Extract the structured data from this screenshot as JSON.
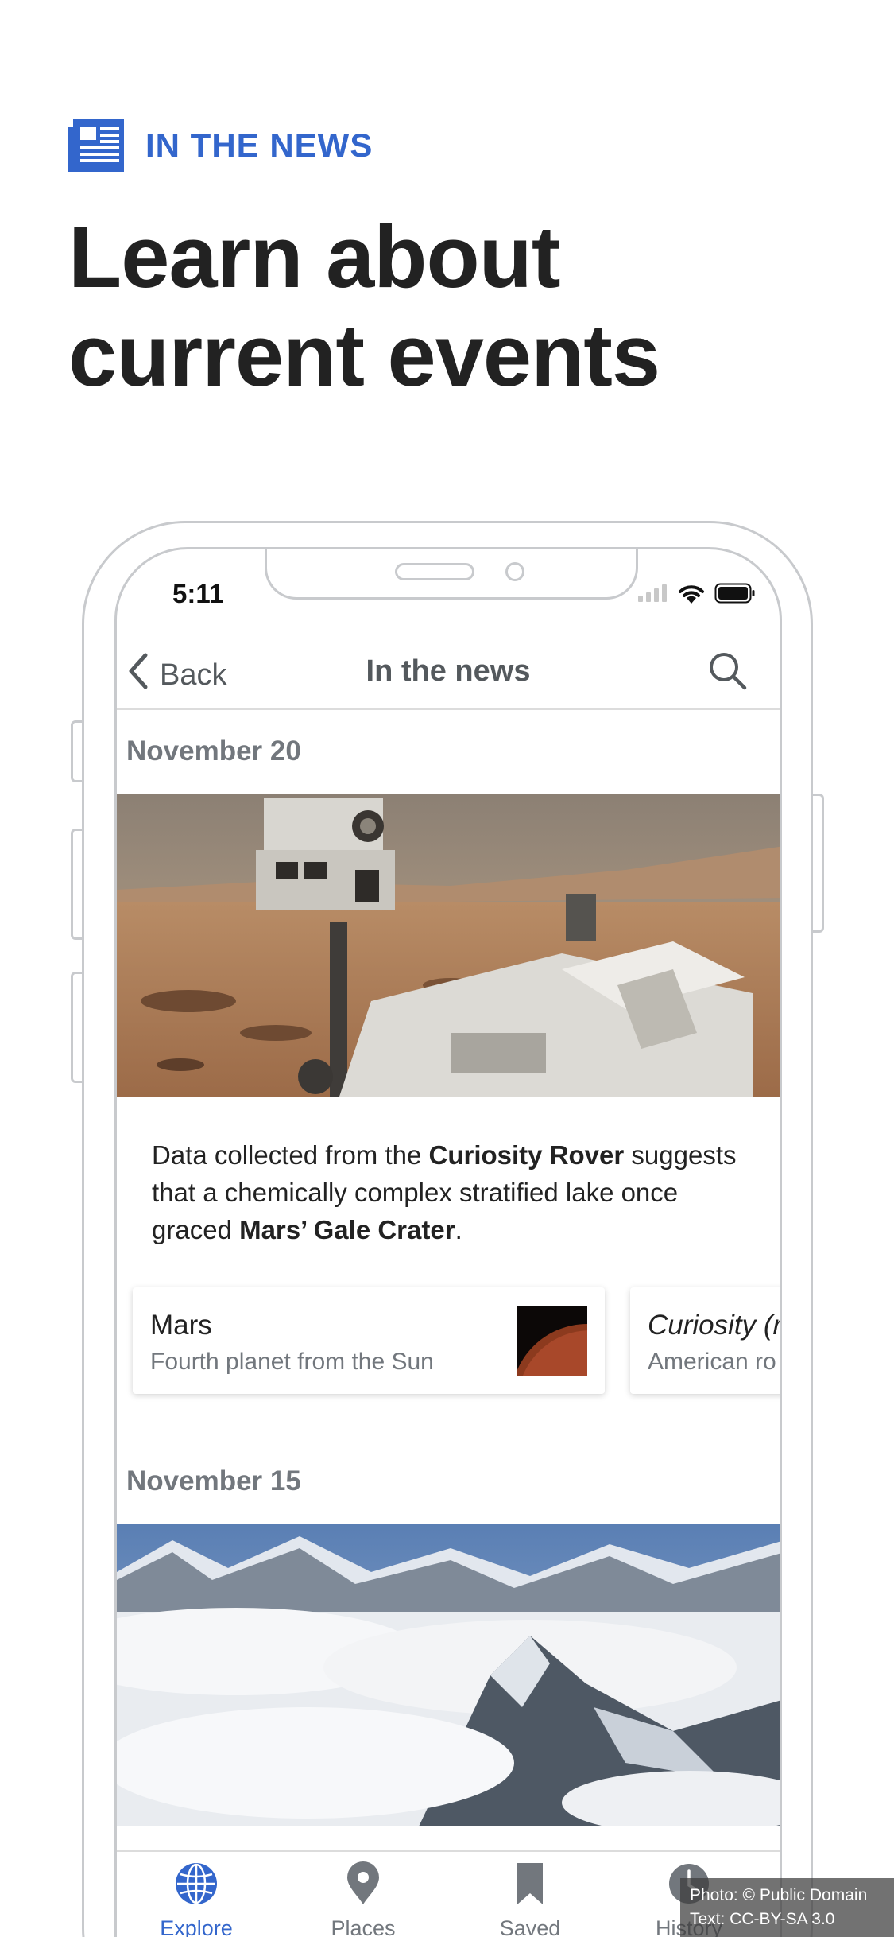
{
  "promo": {
    "eyebrow": "IN THE NEWS",
    "headline_line1": "Learn about",
    "headline_line2": "current events"
  },
  "status_bar": {
    "time": "5:11"
  },
  "nav": {
    "back_label": "Back",
    "title": "In the news"
  },
  "sections": [
    {
      "date": "November 20",
      "story_parts": {
        "p1": "Data collected from the ",
        "b1": "Curiosity Rover",
        "p2": " suggests that a chemically complex stratified lake once graced ",
        "b2": "Mars’ Gale Crater",
        "p3": "."
      },
      "cards": [
        {
          "title": "Mars",
          "description": "Fourth planet from the Sun"
        },
        {
          "title": "Curiosity (r",
          "description": "American ro"
        }
      ]
    },
    {
      "date": "November 15"
    }
  ],
  "tabs": [
    {
      "label": "Explore"
    },
    {
      "label": "Places"
    },
    {
      "label": "Saved"
    },
    {
      "label": "History"
    }
  ],
  "attribution": {
    "photo": "Photo: © Public Domain",
    "text": "Text: CC-BY-SA 3.0"
  },
  "colors": {
    "accent": "#3366cc",
    "text_primary": "#222222",
    "text_secondary": "#72777d",
    "nav_gray": "#54595d",
    "frame": "#c8cacd"
  }
}
